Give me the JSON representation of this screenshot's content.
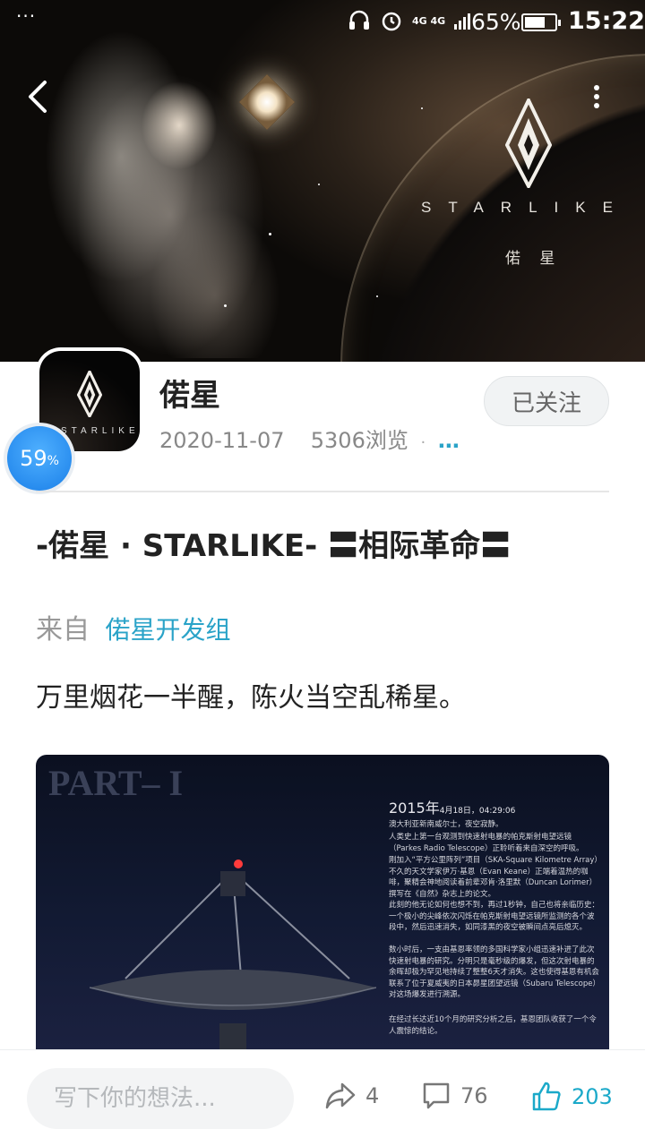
{
  "status_bar": {
    "notification_dots": "···",
    "network": "4G 4G",
    "battery_percent": "65%",
    "battery_level": 0.65,
    "time": "15:22",
    "icons": [
      "headphones-icon",
      "alarm-icon",
      "signal-icon",
      "battery-icon"
    ]
  },
  "header": {
    "back_icon": "chevron-left-icon",
    "more_icon": "more-vertical-icon",
    "banner": {
      "brand_text": "STARLIKE",
      "brand_cn": "偌 星"
    }
  },
  "profile": {
    "avatar_text": "STARLIKE",
    "progress": {
      "value": "59",
      "unit": "%",
      "fraction": 0.59
    },
    "name": "偌星",
    "date": "2020-11-07",
    "views": "5306浏览",
    "separator": "·",
    "more": "…",
    "follow_label": "已关注"
  },
  "article": {
    "title": "-偌星 · STARLIKE-   〓相际革命〓",
    "source_label": "来自",
    "source_group": "偌星开发组",
    "body": "万里烟花一半醒，陈火当空乱稀星。",
    "image": {
      "part_label": "PART– I",
      "year": "2015年",
      "date_time": "4月18日，04:29:06",
      "paragraphs": [
        "澳大利亚新南威尔士，夜空寂静。",
        "人类史上第一台观测到快速射电暴的帕克斯射电望远镜（Parkes Radio Telescope）正聆听着来自深空的呼吸。",
        "刚加入“平方公里阵列”项目（SKA-Square Kilometre Array）不久的天文学家伊万·基恩（Evan Keane）正端着温热的咖啡，聚精会神地阅读着前辈邓肯·洛里默（Duncan Lorimer）撰写在《自然》杂志上的论文。",
        "此刻的他无论如何也想不到，再过1秒钟，自己也将亲临历史：一个极小的尖峰依次闪烁在帕克斯射电望远镜所监测的各个波段中，然后迅速消失，如同漆黑的夜空被瞬间点亮后熄灭。",
        "数小时后，一支由基恩率领的多国科学家小组迅速补进了此次快速射电暴的研究。分明只是毫秒级的爆发，但这次射电暴的余晖却极为罕见地持续了整整6天才消失。这也使得基恩有机会联系了位于夏威夷的日本昴星团望远镜（Subaru Telescope）对这场爆发进行溯源。",
        "在经过长达近10个月的研究分析之后，基恩团队收获了一个令人震惊的结论。"
      ]
    }
  },
  "bottom_bar": {
    "comment_placeholder": "写下你的想法...",
    "share_count": "4",
    "comment_count": "76",
    "like_count": "203",
    "accent_color": "#1ba9c9"
  }
}
